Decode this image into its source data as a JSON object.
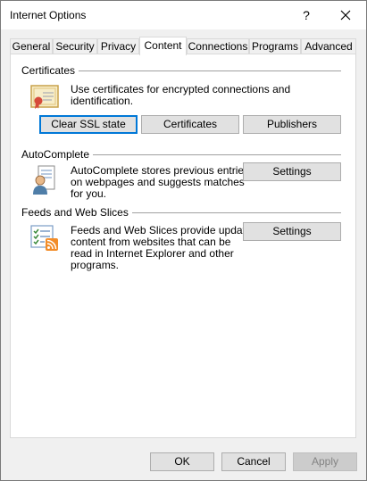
{
  "window": {
    "title": "Internet Options",
    "help_label": "?"
  },
  "tabs": [
    {
      "label": "General"
    },
    {
      "label": "Security"
    },
    {
      "label": "Privacy"
    },
    {
      "label": "Content",
      "active": true
    },
    {
      "label": "Connections"
    },
    {
      "label": "Programs"
    },
    {
      "label": "Advanced"
    }
  ],
  "certificates": {
    "heading": "Certificates",
    "description": "Use certificates for encrypted connections and identification.",
    "icon": "certificate-icon",
    "buttons": {
      "clear_ssl": "Clear SSL state",
      "certificates": "Certificates",
      "publishers": "Publishers"
    }
  },
  "autocomplete": {
    "heading": "AutoComplete",
    "description_lines": [
      "AutoComplete stores previous entries",
      "on webpages and suggests matches",
      "for you."
    ],
    "icon": "user-form-icon",
    "settings_label": "Settings"
  },
  "feeds": {
    "heading": "Feeds and Web Slices",
    "description_lines": [
      "Feeds and Web Slices provide updated",
      "content from websites that can be",
      "read in Internet Explorer and other",
      "programs."
    ],
    "icon": "rss-feed-icon",
    "settings_label": "Settings"
  },
  "footer": {
    "ok": "OK",
    "cancel": "Cancel",
    "apply": "Apply"
  },
  "colors": {
    "default_button_border": "#0078d7",
    "rss_orange": "#f28c28"
  }
}
